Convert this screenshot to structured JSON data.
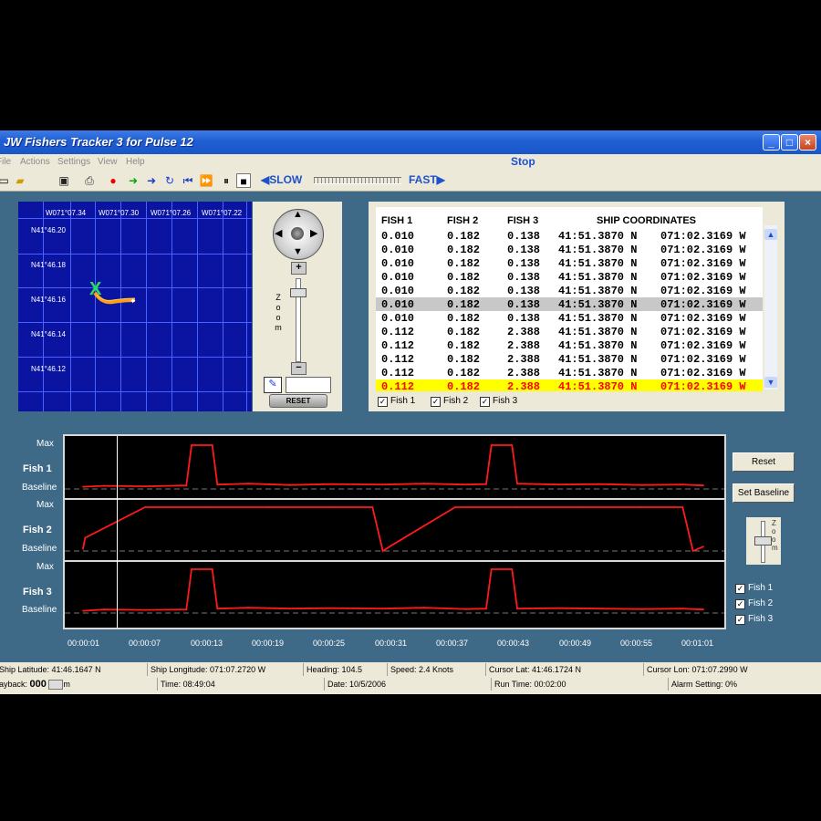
{
  "window": {
    "title": "JW Fishers Tracker 3 for Pulse 12",
    "state": "Stop"
  },
  "menu": [
    "File",
    "Actions",
    "Settings",
    "View",
    "Help"
  ],
  "toolbar": {
    "slow_label": "SLOW",
    "fast_label": "FAST"
  },
  "map": {
    "lon_labels": [
      "W071°07.34",
      "W071°07.30",
      "W071°07.26",
      "W071°07.22"
    ],
    "lat_labels": [
      "N41°46.20",
      "N41°46.18",
      "N41°46.16",
      "N41°46.14",
      "N41°46.12"
    ]
  },
  "controls": {
    "zoom_label": "Zoom",
    "reset_label": "RESET",
    "zoom_in": "+",
    "zoom_out": "−"
  },
  "table": {
    "headers": [
      "FISH 1",
      "FISH 2",
      "FISH 3",
      "SHIP COORDINATES"
    ],
    "rows": [
      [
        "0.010",
        "0.182",
        "0.138",
        "41:51.3870 N",
        "071:02.3169 W"
      ],
      [
        "0.010",
        "0.182",
        "0.138",
        "41:51.3870 N",
        "071:02.3169 W"
      ],
      [
        "0.010",
        "0.182",
        "0.138",
        "41:51.3870 N",
        "071:02.3169 W"
      ],
      [
        "0.010",
        "0.182",
        "0.138",
        "41:51.3870 N",
        "071:02.3169 W"
      ],
      [
        "0.010",
        "0.182",
        "0.138",
        "41:51.3870 N",
        "071:02.3169 W"
      ],
      [
        "0.010",
        "0.182",
        "0.138",
        "41:51.3870 N",
        "071:02.3169 W"
      ],
      [
        "0.010",
        "0.182",
        "0.138",
        "41:51.3870 N",
        "071:02.3169 W"
      ],
      [
        "0.112",
        "0.182",
        "2.388",
        "41:51.3870 N",
        "071:02.3169 W"
      ],
      [
        "0.112",
        "0.182",
        "2.388",
        "41:51.3870 N",
        "071:02.3169 W"
      ],
      [
        "0.112",
        "0.182",
        "2.388",
        "41:51.3870 N",
        "071:02.3169 W"
      ],
      [
        "0.112",
        "0.182",
        "2.388",
        "41:51.3870 N",
        "071:02.3169 W"
      ],
      [
        "0.112",
        "0.182",
        "2.388",
        "41:51.3870 N",
        "071:02.3169 W"
      ],
      [
        "0.112",
        "0.182",
        "2.388",
        "41:51.3870 N",
        "071:02.3169 W"
      ]
    ],
    "selected_row": 5,
    "alarm_rows": [
      11,
      12
    ],
    "checkboxes": [
      "Fish 1",
      "Fish 2",
      "Fish 3"
    ]
  },
  "plots": {
    "max_label": "Max",
    "baseline_label": "Baseline",
    "fish_labels": [
      "Fish 1",
      "Fish 2",
      "Fish 3"
    ],
    "time_ticks": [
      "00:00:01",
      "00:00:07",
      "00:00:13",
      "00:00:19",
      "00:00:25",
      "00:00:31",
      "00:00:37",
      "00:00:43",
      "00:00:49",
      "00:00:55",
      "00:01:01"
    ],
    "reset_label": "Reset",
    "set_baseline_label": "Set Baseline",
    "zoom_label": "Zoom",
    "checkboxes": [
      "Fish 1",
      "Fish 2",
      "Fish 3"
    ],
    "line_color": "#ff1a1a"
  },
  "chart_data": [
    {
      "type": "line",
      "title": "Fish 1",
      "x_unit": "seconds",
      "x": [
        1,
        3,
        7,
        11,
        11.5,
        13.5,
        14,
        17,
        21,
        25,
        30,
        34,
        38,
        40,
        40.5,
        42.5,
        43,
        47,
        51,
        55,
        59,
        61
      ],
      "y": [
        0.05,
        0.07,
        0.06,
        0.08,
        1.0,
        1.0,
        0.1,
        0.12,
        0.09,
        0.11,
        0.1,
        0.12,
        0.1,
        0.11,
        1.0,
        1.0,
        0.12,
        0.1,
        0.11,
        0.09,
        0.1,
        0.08
      ],
      "ylim": [
        0,
        1
      ]
    },
    {
      "type": "line",
      "title": "Fish 2",
      "x_unit": "seconds",
      "x": [
        1,
        1.2,
        7,
        13,
        19,
        25,
        29,
        30,
        31,
        37,
        43,
        49,
        55,
        59,
        60,
        61
      ],
      "y": [
        0.05,
        0.3,
        1.0,
        1.0,
        1.0,
        1.0,
        1.0,
        0.0,
        0.15,
        1.0,
        1.0,
        1.0,
        1.0,
        1.0,
        0.0,
        0.1
      ],
      "ylim": [
        0,
        1
      ]
    },
    {
      "type": "line",
      "title": "Fish 3",
      "x_unit": "seconds",
      "x": [
        1,
        3,
        7,
        11,
        11.5,
        13.5,
        14,
        17,
        21,
        25,
        30,
        34,
        38,
        40,
        40.5,
        42.5,
        43,
        47,
        51,
        55,
        59,
        61
      ],
      "y": [
        0.05,
        0.08,
        0.07,
        0.08,
        1.0,
        1.0,
        0.1,
        0.12,
        0.1,
        0.11,
        0.1,
        0.12,
        0.09,
        0.1,
        1.0,
        1.0,
        0.1,
        0.11,
        0.1,
        0.09,
        0.1,
        0.08
      ],
      "ylim": [
        0,
        1
      ]
    }
  ],
  "status": {
    "ship_latitude": "Ship Latitude: 41:46.1647 N",
    "ship_longitude": "Ship Longitude: 071:07.2720 W",
    "heading": "Heading: 104.5",
    "speed": "Speed: 2.4 Knots",
    "cursor_lat": "Cursor Lat: 41:46.1724 N",
    "cursor_lon": "Cursor Lon: 071:07.2990 W",
    "playback_label": "Playback:",
    "playback_value": "000",
    "playback_unit": "m",
    "time": "Time: 08:49:04",
    "date": "Date: 10/5/2006",
    "run_time": "Run Time: 00:02:00",
    "alarm": "Alarm Setting: 0%"
  }
}
